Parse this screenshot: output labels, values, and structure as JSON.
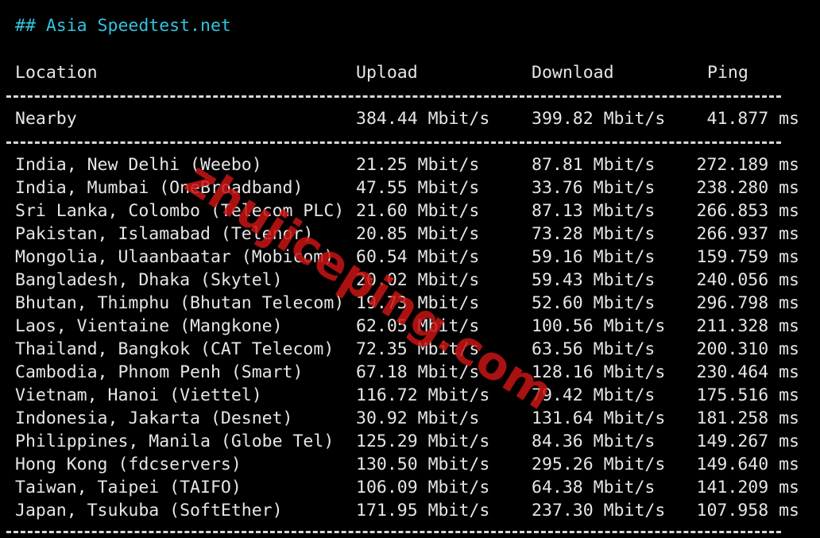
{
  "heading": "## Asia Speedtest.net",
  "columns": {
    "location": "Location",
    "upload": "Upload",
    "download": "Download",
    "ping": "Ping"
  },
  "nearby": {
    "location": "Nearby",
    "upload": "384.44 Mbit/s",
    "download": "399.82 Mbit/s",
    "ping": "41.877 ms"
  },
  "rows": [
    {
      "location": "India, New Delhi (Weebo)",
      "upload": "21.25 Mbit/s",
      "download": "87.81 Mbit/s",
      "ping": "272.189 ms"
    },
    {
      "location": "India, Mumbai (OneBroadband)",
      "upload": "47.55 Mbit/s",
      "download": "33.76 Mbit/s",
      "ping": "238.280 ms"
    },
    {
      "location": "Sri Lanka, Colombo (Telecom PLC)",
      "upload": "21.60 Mbit/s",
      "download": "87.13 Mbit/s",
      "ping": "266.853 ms"
    },
    {
      "location": "Pakistan, Islamabad (Telenor)",
      "upload": "20.85 Mbit/s",
      "download": "73.28 Mbit/s",
      "ping": "266.937 ms"
    },
    {
      "location": "Mongolia, Ulaanbaatar (Mobicom)",
      "upload": "60.54 Mbit/s",
      "download": "59.16 Mbit/s",
      "ping": "159.759 ms"
    },
    {
      "location": "Bangladesh, Dhaka (Skytel)",
      "upload": "20.02 Mbit/s",
      "download": "59.43 Mbit/s",
      "ping": "240.056 ms"
    },
    {
      "location": "Bhutan, Thimphu (Bhutan Telecom)",
      "upload": "19.73 Mbit/s",
      "download": "52.60 Mbit/s",
      "ping": "296.798 ms"
    },
    {
      "location": "Laos, Vientaine (Mangkone)",
      "upload": "62.05 Mbit/s",
      "download": "100.56 Mbit/s",
      "ping": "211.328 ms"
    },
    {
      "location": "Thailand, Bangkok (CAT Telecom)",
      "upload": "72.35 Mbit/s",
      "download": "63.56 Mbit/s",
      "ping": "200.310 ms"
    },
    {
      "location": "Cambodia, Phnom Penh (Smart)",
      "upload": "67.18 Mbit/s",
      "download": "128.16 Mbit/s",
      "ping": "230.464 ms"
    },
    {
      "location": "Vietnam, Hanoi (Viettel)",
      "upload": "116.72 Mbit/s",
      "download": "79.42 Mbit/s",
      "ping": "175.516 ms"
    },
    {
      "location": "Indonesia, Jakarta (Desnet)",
      "upload": "30.92 Mbit/s",
      "download": "131.64 Mbit/s",
      "ping": "181.258 ms"
    },
    {
      "location": "Philippines, Manila (Globe Tel)",
      "upload": "125.29 Mbit/s",
      "download": "84.36 Mbit/s",
      "ping": "149.267 ms"
    },
    {
      "location": "Hong Kong (fdcservers)",
      "upload": "130.50 Mbit/s",
      "download": "295.26 Mbit/s",
      "ping": "149.640 ms"
    },
    {
      "location": "Taiwan, Taipei (TAIFO)",
      "upload": "106.09 Mbit/s",
      "download": "64.38 Mbit/s",
      "ping": "141.209 ms"
    },
    {
      "location": "Japan, Tsukuba (SoftEther)",
      "upload": "171.95 Mbit/s",
      "download": "237.30 Mbit/s",
      "ping": "107.958 ms"
    }
  ],
  "watermark": "zhujiceping.com",
  "colors": {
    "background": "#000000",
    "text": "#e6e6e6",
    "heading": "#33c3e0",
    "watermark": "#c81414"
  }
}
